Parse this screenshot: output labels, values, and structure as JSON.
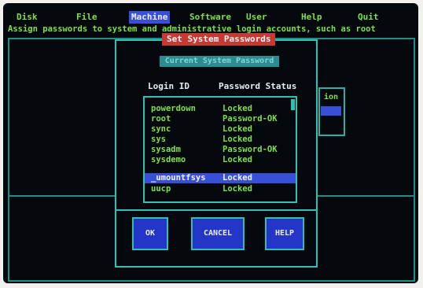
{
  "menu": [
    {
      "label": "Disk",
      "active": false
    },
    {
      "label": "File",
      "active": false
    },
    {
      "label": "Machine",
      "active": true
    },
    {
      "label": "Software",
      "active": false
    },
    {
      "label": "User",
      "active": false
    },
    {
      "label": "Help",
      "active": false
    },
    {
      "label": "Quit",
      "active": false
    }
  ],
  "hint": "Assign passwords to system and administrative login accounts, such as root",
  "dialog": {
    "title": "Set System Passwords",
    "input_value": "Current System Password",
    "col_login": "Login ID",
    "col_status": "Password Status",
    "rows": [
      {
        "id": "powerdown",
        "status": "Locked",
        "selected": false
      },
      {
        "id": "root",
        "status": "Password-OK",
        "selected": false
      },
      {
        "id": "sync",
        "status": "Locked",
        "selected": false
      },
      {
        "id": "sys",
        "status": "Locked",
        "selected": false
      },
      {
        "id": "sysadm",
        "status": "Password-OK",
        "selected": false
      },
      {
        "id": "sysdemo",
        "status": "Locked",
        "selected": false
      },
      {
        "id": "_umountfsys",
        "status": "Locked",
        "selected": true
      },
      {
        "id": "uucp",
        "status": "Locked",
        "selected": false
      }
    ],
    "buttons": {
      "ok": "OK",
      "cancel": "CANCEL",
      "help": "HELP"
    }
  },
  "background_panel": {
    "label": "ion"
  },
  "colors": {
    "text_green": "#7fe04a",
    "highlight_blue": "#3a4fd8",
    "frame_teal": "#2fc0b4",
    "title_red": "#c63a34",
    "button_blue": "#2435c8"
  }
}
